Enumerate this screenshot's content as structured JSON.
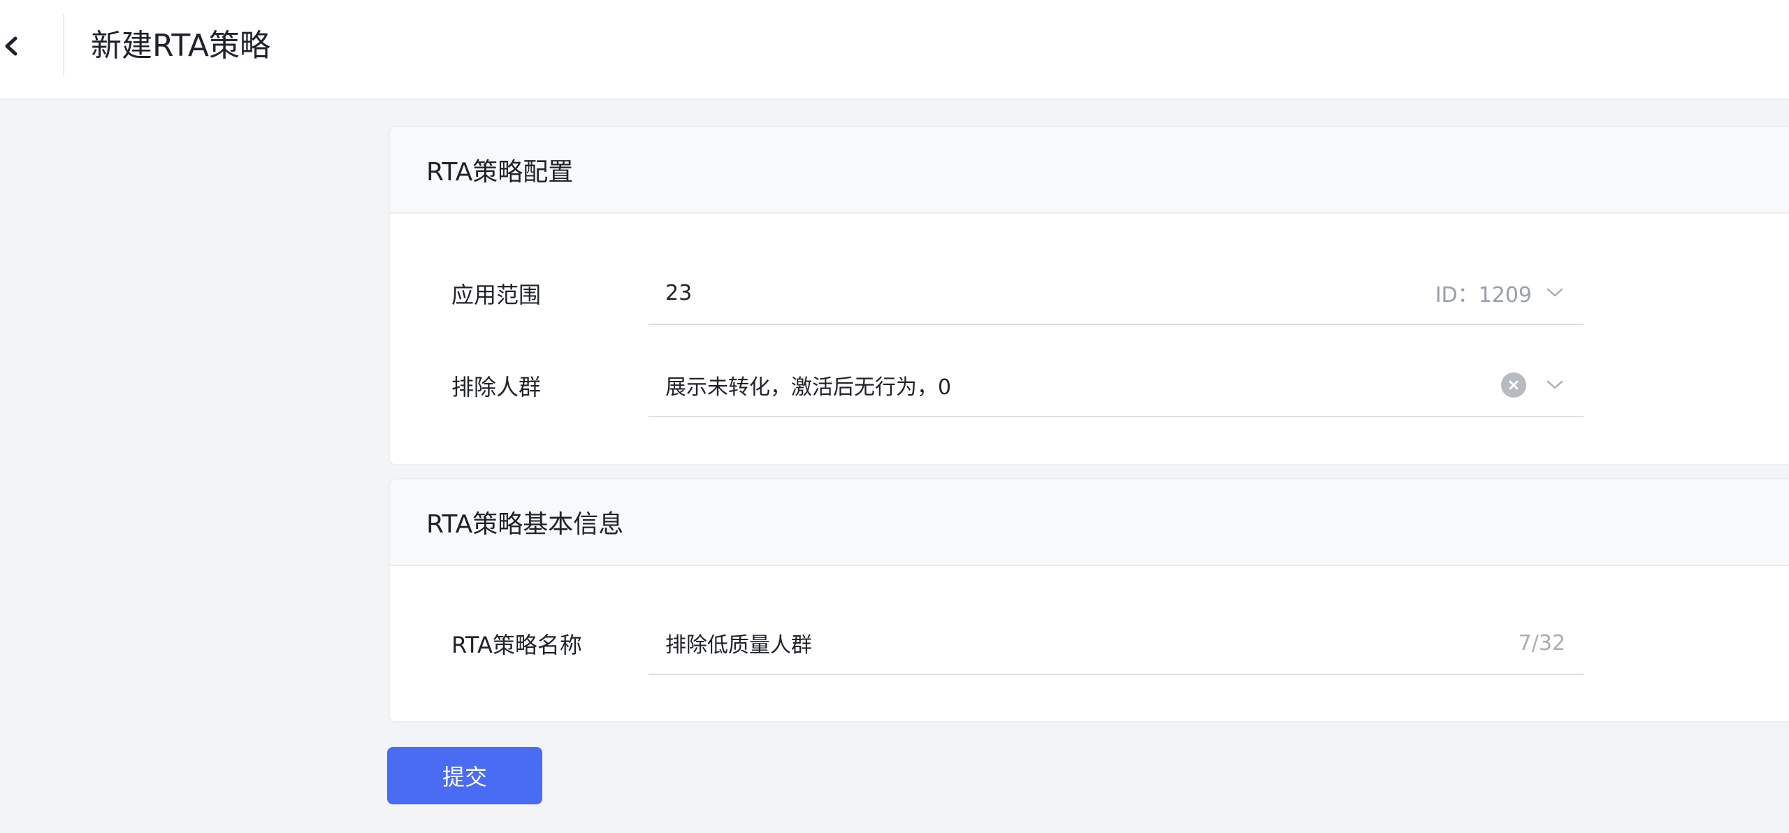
{
  "header": {
    "back_icon": "chevron-left-icon",
    "title": "新建RTA策略"
  },
  "config_card": {
    "title": "RTA策略配置",
    "scope": {
      "label": "应用范围",
      "value": "23",
      "suffix": "ID：1209"
    },
    "exclude": {
      "label": "排除人群",
      "value": "展示未转化，激活后无行为，0"
    }
  },
  "info_card": {
    "title": "RTA策略基本信息",
    "name": {
      "label": "RTA策略名称",
      "value": "排除低质量人群",
      "counter": "7/32"
    }
  },
  "submit_label": "提交",
  "colors": {
    "accent": "#4a6cf2",
    "background": "#f3f4f6"
  }
}
